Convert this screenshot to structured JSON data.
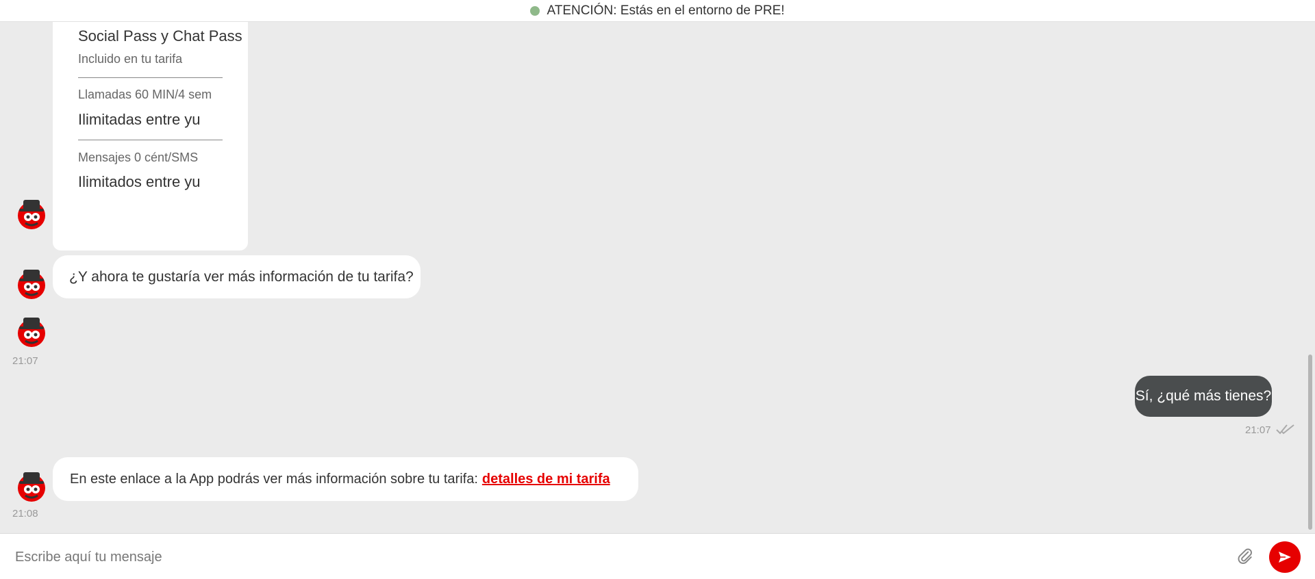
{
  "banner": {
    "text": "ATENCIÓN: Estás en el entorno de PRE!",
    "dot_color": "#8fb98a"
  },
  "card": {
    "items": [
      {
        "title": "Social Pass y Chat Pass",
        "subtitle": "Incluido en tu tarifa"
      },
      {
        "label": "Llamadas 60 MIN/4 sem",
        "value": "Ilimitadas entre yu"
      },
      {
        "label": "Mensajes 0 cént/SMS",
        "value": "Ilimitados entre yu"
      }
    ]
  },
  "messages": {
    "bot_question": "¿Y ahora te gustaría ver más información de tu tarifa?",
    "time_1": "21:07",
    "user_reply": "Sí, ¿qué más tienes?",
    "user_time": "21:07",
    "bot_link_text": "En este enlace a la App  podrás ver más información sobre tu tarifa:",
    "bot_link_label": "detalles de mi tarifa",
    "time_2": "21:08"
  },
  "composer": {
    "placeholder": "Escribe aquí tu mensaje",
    "value": ""
  },
  "icons": {
    "avatar": "bot-avatar-icon",
    "read_receipt": "double-check-icon",
    "attach": "paperclip-icon",
    "send": "send-icon"
  },
  "colors": {
    "accent": "#e60000",
    "user_bubble": "#4a4d4e",
    "background": "#ebebeb"
  }
}
